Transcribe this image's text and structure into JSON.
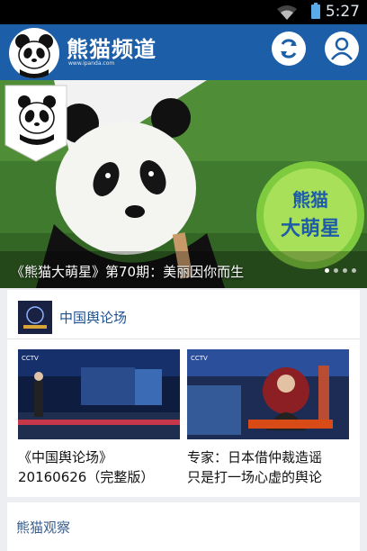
{
  "status": {
    "time": "5:27"
  },
  "app": {
    "title": "熊猫频道",
    "subtitle": "www.ipanda.com",
    "colors": {
      "appbar": "#1c5fa8",
      "accent": "#1e4f8f"
    }
  },
  "hero": {
    "caption": "《熊猫大萌星》第70期：美丽因你而生",
    "badge_text": "熊猫大萌星",
    "page_dots": 4,
    "active_dot": 1
  },
  "section1": {
    "title": "中国舆论场",
    "items": [
      {
        "lines": [
          "《中国舆论场》",
          "20160626（完整版）"
        ]
      },
      {
        "lines": [
          "专家：日本借仲裁造谣",
          "只是打一场心虚的舆论"
        ]
      }
    ]
  },
  "section2": {
    "title": "熊猫观察"
  }
}
